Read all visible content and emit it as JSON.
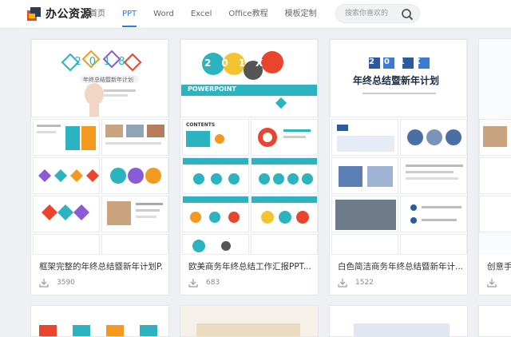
{
  "header": {
    "logo_text": "办公资源",
    "nav": [
      "首页",
      "PPT",
      "Word",
      "Excel",
      "Office教程",
      "模板定制"
    ],
    "active_nav": "PPT",
    "search_placeholder": "搜索你喜欢的"
  },
  "cards": [
    {
      "title": "框架完整的年终总结暨新年计划P...",
      "downloads": "3590",
      "preview_year": "2018",
      "preview_subtitle": "年终总结暨新年计划"
    },
    {
      "title": "欧美商务年终总结工作汇报PPT...",
      "downloads": "683",
      "preview_year": "201X",
      "preview_banner": "POWERPOINT",
      "preview_contents": "CONTENTS"
    },
    {
      "title": "白色简洁商务年终总结暨新年计...",
      "downloads": "1522",
      "preview_year": "201X",
      "preview_heading": "年终总结暨新年计划"
    },
    {
      "title": "创意手",
      "downloads": ""
    }
  ],
  "colors": {
    "accent": "#2c7be5",
    "teal": "#2bb3c0",
    "orange": "#f39a1e",
    "purple": "#8a5bd6"
  }
}
